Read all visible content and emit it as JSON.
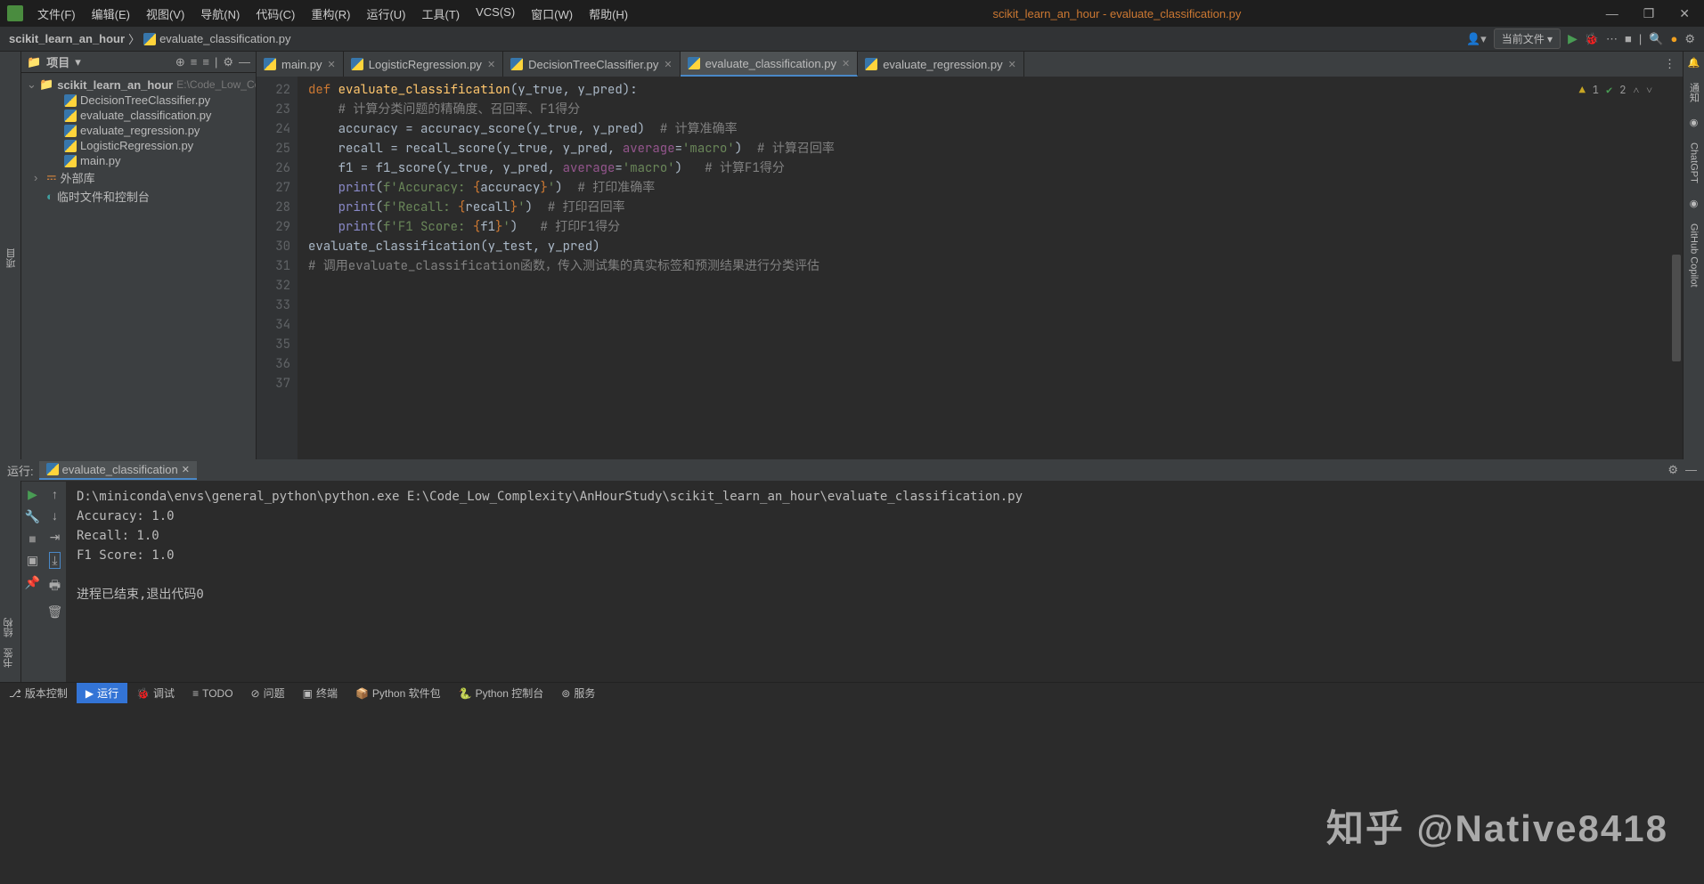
{
  "window": {
    "title": "scikit_learn_an_hour - evaluate_classification.py"
  },
  "menu": {
    "file": "文件(F)",
    "edit": "编辑(E)",
    "view": "视图(V)",
    "nav": "导航(N)",
    "code": "代码(C)",
    "refactor": "重构(R)",
    "run": "运行(U)",
    "tools": "工具(T)",
    "vcs": "VCS(S)",
    "window": "窗口(W)",
    "help": "帮助(H)"
  },
  "breadcrumb": {
    "root": "scikit_learn_an_hour",
    "file": "evaluate_classification.py"
  },
  "toolbar": {
    "config_label": "当前文件",
    "search_placeholder": "搜索"
  },
  "projectPanel": {
    "title": "项目",
    "root": "scikit_learn_an_hour",
    "rootPath": "E:\\Code_Low_Con",
    "files": [
      "DecisionTreeClassifier.py",
      "evaluate_classification.py",
      "evaluate_regression.py",
      "LogisticRegression.py",
      "main.py"
    ],
    "extLib": "外部库",
    "scratch": "临时文件和控制台"
  },
  "leftRail": {
    "project": "项目"
  },
  "leftRail2": {
    "structure": "结构",
    "bookmarks": "书签"
  },
  "rightRail": {
    "notifications": "通知",
    "chatgpt": "ChatGPT",
    "copilot": "GitHub Copilot"
  },
  "tabs": [
    {
      "name": "main.py"
    },
    {
      "name": "LogisticRegression.py"
    },
    {
      "name": "DecisionTreeClassifier.py"
    },
    {
      "name": "evaluate_classification.py",
      "active": true
    },
    {
      "name": "evaluate_regression.py"
    }
  ],
  "inspection": {
    "warn_count": "1",
    "ok_count": "2"
  },
  "gutter": {
    "start": 22,
    "end": 37
  },
  "code": {
    "l24_def": "def ",
    "l24_fn": "evaluate_classification",
    "l24_args": "(y_true, y_pred):",
    "l25_cmt": "# 计算分类问题的精确度、召回率、F1得分",
    "l26_a": "accuracy = accuracy_score(y_true, y_pred)  ",
    "l26_cmt": "# 计算准确率",
    "l27_a": "recall = recall_score(y_true, y_pred, ",
    "l27_kw": "average",
    "l27_b": "=",
    "l27_str": "'macro'",
    "l27_c": ")  ",
    "l27_cmt": "# 计算召回率",
    "l28_a": "f1 = f1_score(y_true, y_pred, ",
    "l28_kw": "average",
    "l28_b": "=",
    "l28_str": "'macro'",
    "l28_c": ")   ",
    "l28_cmt": "# 计算F1得分",
    "l30_p": "print",
    "l30_a": "(",
    "l30_f": "f'Accuracy: ",
    "l30_b": "{",
    "l30_v": "accuracy",
    "l30_c": "}",
    "l30_e": "'",
    "l30_d": ")  ",
    "l30_cmt": "# 打印准确率",
    "l31_p": "print",
    "l31_a": "(",
    "l31_f": "f'Recall: ",
    "l31_b": "{",
    "l31_v": "recall",
    "l31_c": "}",
    "l31_e": "'",
    "l31_d": ")  ",
    "l31_cmt": "# 打印召回率",
    "l32_p": "print",
    "l32_a": "(",
    "l32_f": "f'F1 Score: ",
    "l32_b": "{",
    "l32_v": "f1",
    "l32_c": "}",
    "l32_e": "'",
    "l32_d": ")   ",
    "l32_cmt": "# 打印F1得分",
    "l35": "evaluate_classification(y_test, y_pred)",
    "l36_cmt": "# 调用evaluate_classification函数，传入测试集的真实标签和预测结果进行分类评估"
  },
  "runPanel": {
    "label": "运行:",
    "tab": "evaluate_classification",
    "output": {
      "cmd": "D:\\miniconda\\envs\\general_python\\python.exe E:\\Code_Low_Complexity\\AnHourStudy\\scikit_learn_an_hour\\evaluate_classification.py",
      "l1": "Accuracy: 1.0",
      "l2": "Recall: 1.0",
      "l3": "F1 Score: 1.0",
      "l4": "",
      "l5": "进程已结束,退出代码0"
    }
  },
  "statusBar": {
    "vcs": "版本控制",
    "run": "运行",
    "debug": "调试",
    "todo": "TODO",
    "problems": "问题",
    "terminal": "终端",
    "pypkg": "Python 软件包",
    "pyconsole": "Python 控制台",
    "services": "服务"
  },
  "watermark": {
    "text": "知乎 @Native8418"
  }
}
